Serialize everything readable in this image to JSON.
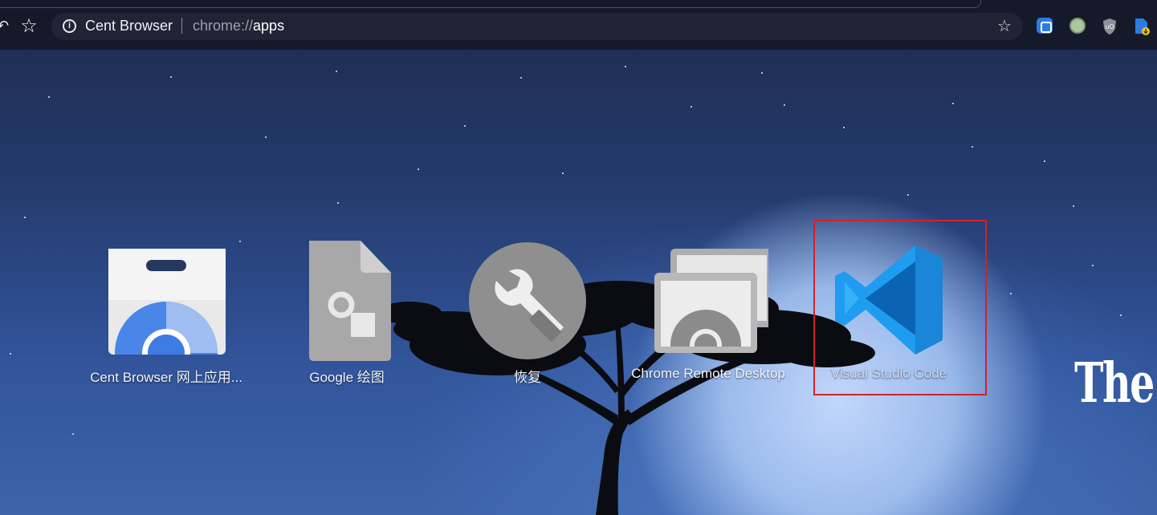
{
  "toolbar": {
    "back_icon": "back-arrow-icon",
    "star_icon": "star-outline-icon",
    "site_name": "Cent Browser",
    "url_scheme": "chrome://",
    "url_host": "apps",
    "bookmark_icon": "bookmark-star-icon",
    "extensions": [
      "extension-blue-icon",
      "extension-green-circle-icon",
      "ublock-shield-icon",
      "download-file-icon"
    ]
  },
  "apps": [
    {
      "label": "Cent Browser 网上应用...",
      "icon": "web-store-icon"
    },
    {
      "label": "Google 绘图",
      "icon": "google-drawings-icon"
    },
    {
      "label": "恢复",
      "icon": "wrench-restore-icon"
    },
    {
      "label": "Chrome Remote Desktop",
      "icon": "remote-desktop-icon"
    },
    {
      "label": "Visual Studio Code",
      "icon": "vscode-icon"
    }
  ],
  "wallpaper_text": "The I",
  "colors": {
    "highlight": "#d61f2b",
    "vscode_blue": "#1f9cf0",
    "toolbar_bg": "#141a2a"
  }
}
